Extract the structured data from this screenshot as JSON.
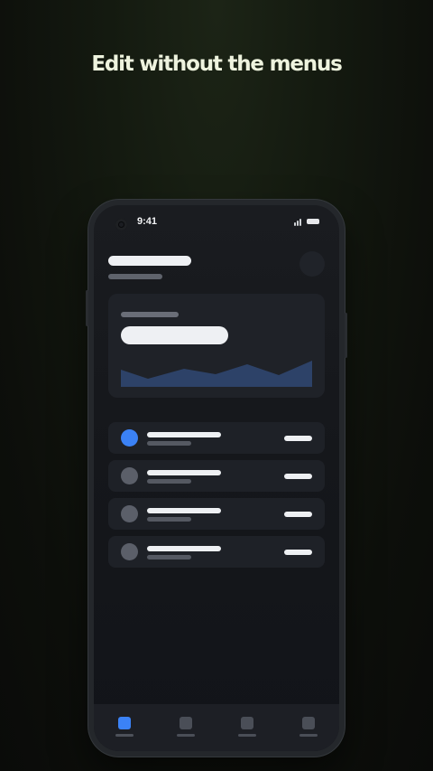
{
  "headline": "Edit without the menus",
  "status_bar": {
    "time": "9:41",
    "icons": [
      "camera-icon",
      "signal-icon",
      "battery-icon"
    ]
  },
  "nav": {
    "items": [
      "tab-1",
      "tab-2",
      "tab-3",
      "tab-4"
    ],
    "active_index": 0
  },
  "colors": {
    "accent": "#3b82f6",
    "placeholder_dark": "#6a6e78",
    "placeholder_light": "#eef0f3",
    "chart_fill": "#2d4268"
  }
}
